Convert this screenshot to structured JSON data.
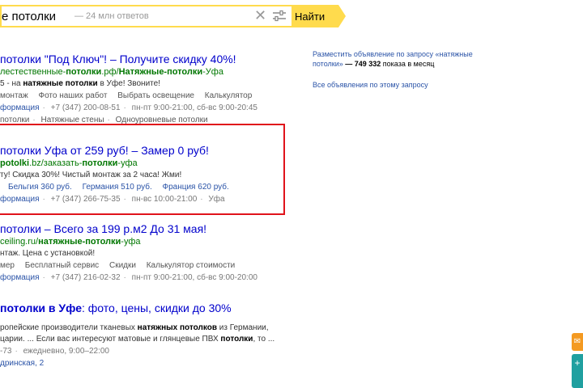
{
  "search": {
    "query": "e потолки",
    "count": "— 24 млн ответов",
    "button_label": "Найти"
  },
  "results": [
    {
      "title_prefix": "потолки",
      "title_rest": " \"Под Ключ\"! – Получите скидку 40%!",
      "url_part1": "лестественные-",
      "url_bold1": "потолки",
      "url_part2": ".рф/",
      "url_bold2": "Натяжные-потолки",
      "url_part3": "-Уфа",
      "text_pre": "5 - на ",
      "text_bold": "натяжные потолки",
      "text_post": " в Уфе! Звоните!",
      "sitelinks_1": [
        "монтаж",
        "Фото наших работ",
        "Выбрать освещение",
        "Калькулятор"
      ],
      "contact": [
        "формация",
        "+7 (347) 200-08-51",
        "пн-пт 9:00-21:00, сб-вс 9:00-20:45"
      ],
      "sitelinks_2": [
        "потолки",
        "Натяжные стены",
        "Одноуровневые потолки"
      ]
    },
    {
      "title_prefix": "потолки",
      "title_rest": " Уфа от 259 руб! – Замер 0 руб!",
      "url_bold1": "potolki",
      "url_part2": ".bz/заказать-",
      "url_bold2": "потолки",
      "url_part3": "-уфа",
      "text": "ту! Скидка 30%! Чистый монтаж за 2 часа! Жми!",
      "sitelinks_1": [
        "Бельгия 360 руб.",
        "Германия 510 руб.",
        "Франция 620 руб."
      ],
      "contact": [
        "формация",
        "+7 (347) 266-75-35",
        "пн-вс 10:00-21:00",
        "Уфа"
      ]
    },
    {
      "title_prefix": "потолки",
      "title_rest": " – Всего за 199 р.м2 До 31 мая!",
      "url_part1": "ceiling.ru/",
      "url_bold": "натяжные-потолки",
      "url_part2": "-уфа",
      "text": "нтаж. Цена с установкой!",
      "sitelinks_1": [
        "мер",
        "Бесплатный сервис",
        "Скидки",
        "Калькулятор стоимости"
      ],
      "contact": [
        "формация",
        "+7 (347) 216-02-32",
        "пн-пт 9:00-21:00, сб-вс 9:00-20:00"
      ]
    },
    {
      "title_bold": "потолки в Уфе",
      "title_rest": ": фото, цены, скидки до 30%",
      "line1_pre": "ропейские производители тканевых ",
      "line1_bold": "натяжных потолков",
      "line1_post": " из Германии,",
      "line2_pre": "царии. ... Если вас интересуют матовые и глянцевые ПВХ ",
      "line2_bold": "потолки",
      "line2_post": ", то ...",
      "contact": [
        "-73",
        "ежедневно, 9:00–22:00"
      ],
      "address": "дринская, 2"
    }
  ],
  "sidebar": {
    "place_ad_text": "Разместить объявление по запросу «натяжные потолки»",
    "place_ad_count": "— 749 332",
    "place_ad_suffix": " показа в месяц",
    "all_ads": "Все объявления по этому запросу"
  },
  "icons": {
    "clear": "close-icon",
    "settings": "settings-sliders-icon"
  },
  "colors": {
    "accent": "#ffdb4d",
    "link": "#0000cc",
    "url": "#007700",
    "highlight": "#e0131b"
  }
}
